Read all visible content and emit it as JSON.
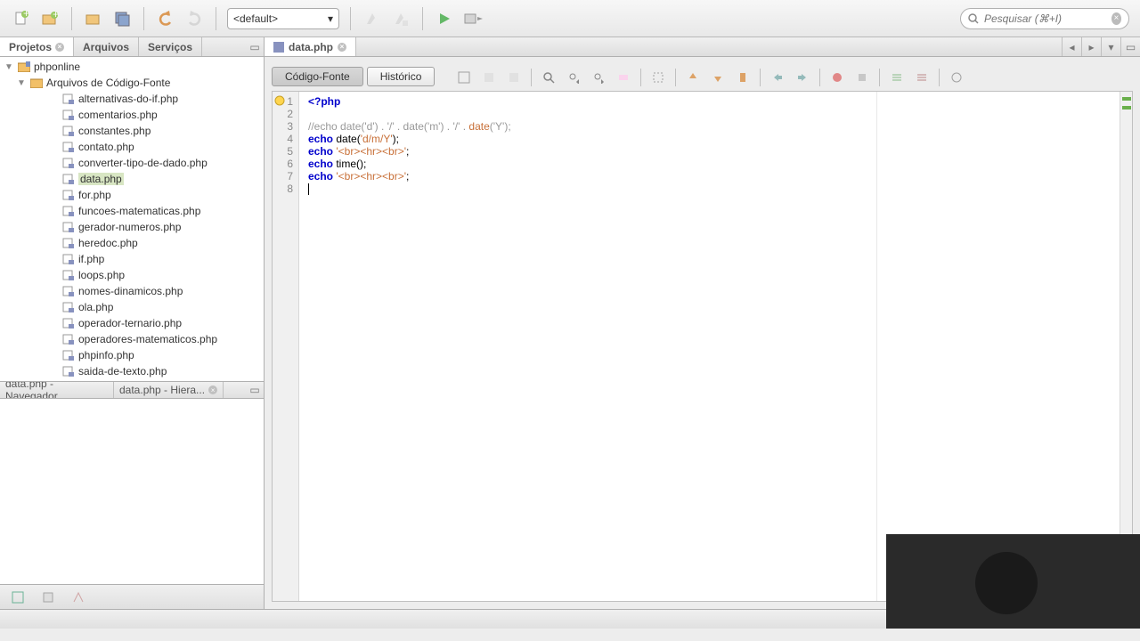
{
  "toolbar": {
    "config_value": "<default>",
    "search_placeholder": "Pesquisar (⌘+I)"
  },
  "leftPanel": {
    "tabs": [
      "Projetos",
      "Arquivos",
      "Serviços"
    ],
    "project": "phponline",
    "sourceFolder": "Arquivos de Código-Fonte",
    "files": [
      "alternativas-do-if.php",
      "comentarios.php",
      "constantes.php",
      "contato.php",
      "converter-tipo-de-dado.php",
      "data.php",
      "for.php",
      "funcoes-matematicas.php",
      "gerador-numeros.php",
      "heredoc.php",
      "if.php",
      "loops.php",
      "nomes-dinamicos.php",
      "ola.php",
      "operador-ternario.php",
      "operadores-matematicos.php",
      "phpinfo.php",
      "saida-de-texto.php"
    ],
    "selectedFile": "data.php",
    "navTabs": [
      "data.php - Navegador",
      "data.php - Hiera..."
    ]
  },
  "editor": {
    "tabName": "data.php",
    "viewSource": "Código-Fonte",
    "viewHistory": "Histórico",
    "lines": [
      "1",
      "2",
      "3",
      "4",
      "5",
      "6",
      "7",
      "8"
    ]
  },
  "code": {
    "l1_tag": "<?php",
    "l3_comment": "//echo date('d') . '/' . date('m') . '/' . ",
    "l3_fn": "date",
    "l3_tail": "('Y');",
    "l4_echo": "echo",
    "l4_a": " date(",
    "l4_str": "'d/m/Y'",
    "l4_b": ");",
    "l5_echo": "echo",
    "l5_sp": " ",
    "l5_str": "'<br><hr><br>'",
    "l5_b": ";",
    "l6_echo": "echo",
    "l6_a": " time();",
    "l7_echo": "echo",
    "l7_sp": " ",
    "l7_str": "'<br><hr><br>'",
    "l7_b": ";"
  }
}
